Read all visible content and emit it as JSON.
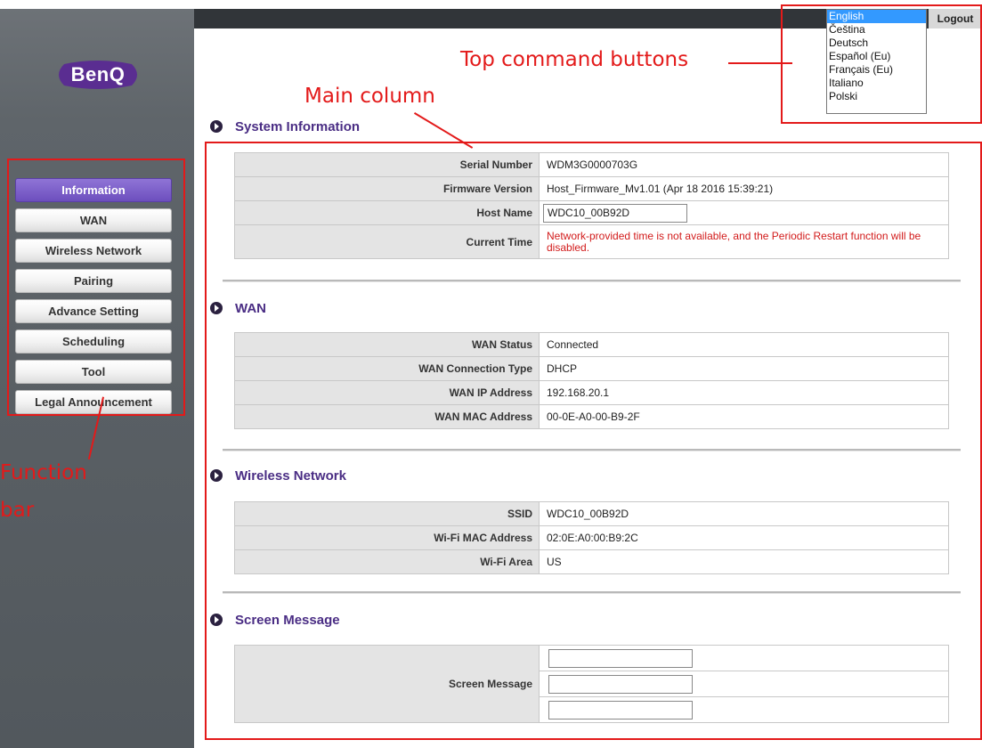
{
  "sidebar": {
    "logo": "BenQ",
    "items": [
      {
        "label": "Information",
        "active": true
      },
      {
        "label": "WAN"
      },
      {
        "label": "Wireless Network"
      },
      {
        "label": "Pairing"
      },
      {
        "label": "Advance Setting"
      },
      {
        "label": "Scheduling"
      },
      {
        "label": "Tool"
      },
      {
        "label": "Legal Announcement"
      }
    ]
  },
  "header": {
    "languages": [
      "English",
      "Čeština",
      "Deutsch",
      "Español (Eu)",
      "Français (Eu)",
      "Italiano",
      "Polski"
    ],
    "selected_language": "English",
    "logout_label": "Logout"
  },
  "sections": {
    "system": {
      "title": "System Information",
      "serial_label": "Serial Number",
      "serial_value": "WDM3G0000703G",
      "firmware_label": "Firmware Version",
      "firmware_value": "Host_Firmware_Mv1.01 (Apr 18 2016 15:39:21)",
      "hostname_label": "Host Name",
      "hostname_value": "WDC10_00B92D",
      "time_label": "Current Time",
      "time_value": "Network-provided time is not available, and the Periodic Restart function will be disabled."
    },
    "wan": {
      "title": "WAN",
      "rows": [
        {
          "label": "WAN Status",
          "value": "Connected"
        },
        {
          "label": "WAN Connection Type",
          "value": "DHCP"
        },
        {
          "label": "WAN IP Address",
          "value": "192.168.20.1"
        },
        {
          "label": "WAN MAC Address",
          "value": "00-0E-A0-00-B9-2F"
        }
      ]
    },
    "wireless": {
      "title": "Wireless Network",
      "rows": [
        {
          "label": "SSID",
          "value": "WDC10_00B92D"
        },
        {
          "label": "Wi-Fi MAC Address",
          "value": "02:0E:A0:00:B9:2C"
        },
        {
          "label": "Wi-Fi Area",
          "value": "US"
        }
      ]
    },
    "screen_message": {
      "title": "Screen Message",
      "label": "Screen Message",
      "inputs": [
        "",
        "",
        ""
      ]
    }
  },
  "annotations": {
    "top_buttons": "Top command buttons",
    "main_column": "Main column",
    "function_bar_line1": "Function",
    "function_bar_line2": "bar"
  },
  "colors": {
    "accent": "#6d4fbe",
    "annotation": "#e31a1a",
    "error_text": "#d21b1b"
  }
}
